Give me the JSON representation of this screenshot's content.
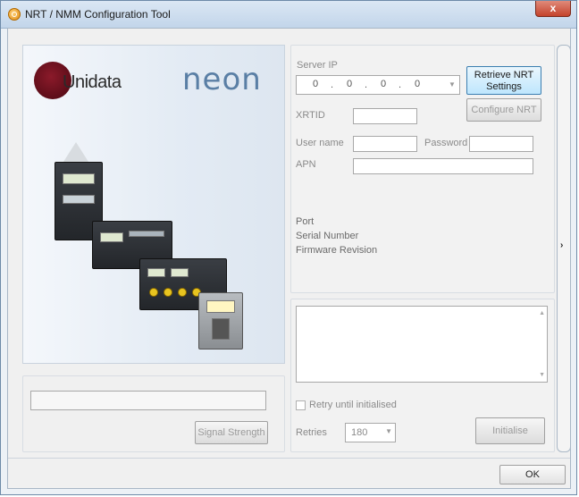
{
  "window": {
    "title": "NRT / NMM Configuration Tool",
    "close_glyph": "x"
  },
  "logos": {
    "unidata": "Unidata",
    "neon": "neon"
  },
  "server": {
    "label": "Server IP",
    "ip_octets": [
      "0",
      "0",
      "0",
      "0"
    ]
  },
  "buttons": {
    "retrieve": "Retrieve NRT Settings",
    "configure": "Configure NRT",
    "signal_strength": "Signal Strength",
    "initialise": "Initialise",
    "ok": "OK"
  },
  "fields": {
    "xrtid_label": "XRTID",
    "username_label": "User name",
    "password_label": "Password",
    "apn_label": "APN"
  },
  "info": {
    "port": "Port",
    "serial_number": "Serial Number",
    "firmware_revision": "Firmware Revision"
  },
  "options": {
    "retry_label": "Retry until initialised",
    "retries_label": "Retries",
    "retries_value": "180"
  }
}
